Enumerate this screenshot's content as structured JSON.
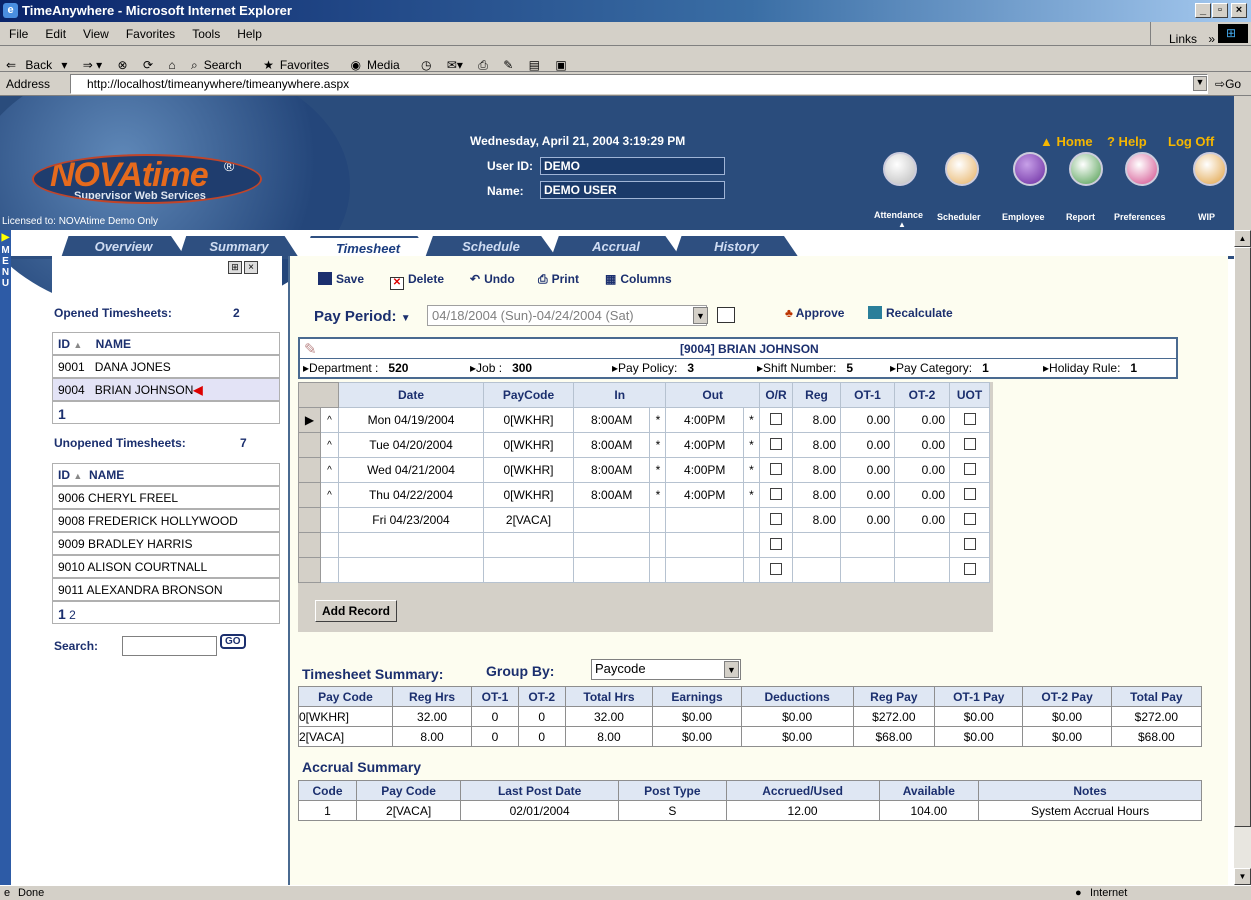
{
  "window": {
    "title": "TimeAnywhere - Microsoft Internet Explorer"
  },
  "menu": [
    "File",
    "Edit",
    "View",
    "Favorites",
    "Tools",
    "Help"
  ],
  "links_label": "Links",
  "toolbar": {
    "back": "Back",
    "search": "Search",
    "favorites": "Favorites",
    "media": "Media"
  },
  "address": {
    "label": "Address",
    "url": "http://localhost/timeanywhere/timeanywhere.aspx",
    "go": "Go"
  },
  "header": {
    "datetime": "Wednesday, April 21, 2004 3:19:29 PM",
    "userid_label": "User ID:",
    "userid": "DEMO",
    "name_label": "Name:",
    "name": "DEMO USER",
    "logo": "NOVAtime",
    "logo_reg": "®",
    "logo_sub": "Supervisor Web Services",
    "licensed": "Licensed to: NOVAtime Demo Only",
    "home": "Home",
    "help": "? Help",
    "logoff": "Log Off",
    "nav": [
      "Attendance",
      "Scheduler",
      "Employee",
      "Report",
      "Preferences",
      "WIP"
    ]
  },
  "menu_strip": "MENU",
  "tabs": [
    "Overview",
    "Summary",
    "Timesheet",
    "Schedule",
    "Accrual",
    "History"
  ],
  "left": {
    "opened_label": "Opened Timesheets:",
    "opened_count": "2",
    "id_hdr": "ID",
    "name_hdr": "NAME",
    "opened": [
      {
        "id": "9001",
        "name": "DANA JONES"
      },
      {
        "id": "9004",
        "name": "BRIAN JOHNSON"
      }
    ],
    "opened_page": "1",
    "unopened_label": "Unopened Timesheets:",
    "unopened_count": "7",
    "unopened": [
      "9006 CHERYL FREEL",
      "9008 FREDERICK HOLLYWOOD",
      "9009 BRADLEY HARRIS",
      "9010 ALISON COURTNALL",
      "9011 ALEXANDRA BRONSON"
    ],
    "pages": [
      "1",
      "2"
    ],
    "search_label": "Search:",
    "go": "GO"
  },
  "actions": {
    "save": "Save",
    "delete": "Delete",
    "undo": "Undo",
    "print": "Print",
    "columns": "Columns"
  },
  "pay_period": {
    "label": "Pay Period:",
    "value": "04/18/2004 (Sun)-04/24/2004 (Sat)",
    "approve": "Approve",
    "recalc": "Recalculate"
  },
  "employee": {
    "title": "[9004] BRIAN JOHNSON",
    "fields": [
      {
        "label": "Department :",
        "value": "520"
      },
      {
        "label": "Job :",
        "value": "300"
      },
      {
        "label": "Pay Policy:",
        "value": "3"
      },
      {
        "label": "Shift Number:",
        "value": "5"
      },
      {
        "label": "Pay Category:",
        "value": "1"
      },
      {
        "label": "Holiday Rule:",
        "value": "1"
      }
    ]
  },
  "timesheet": {
    "columns": [
      "Date",
      "PayCode",
      "In",
      "Out",
      "O/R",
      "Reg",
      "OT-1",
      "OT-2",
      "UOT"
    ],
    "rows": [
      {
        "a": "^",
        "date": "Mon 04/19/2004",
        "pay": "0[WKHR]",
        "in": "8:00AM",
        "is": "*",
        "out": "4:00PM",
        "os": "*",
        "reg": "8.00",
        "ot1": "0.00",
        "ot2": "0.00"
      },
      {
        "a": "^",
        "date": "Tue 04/20/2004",
        "pay": "0[WKHR]",
        "in": "8:00AM",
        "is": "*",
        "out": "4:00PM",
        "os": "*",
        "reg": "8.00",
        "ot1": "0.00",
        "ot2": "0.00"
      },
      {
        "a": "^",
        "date": "Wed 04/21/2004",
        "pay": "0[WKHR]",
        "in": "8:00AM",
        "is": "*",
        "out": "4:00PM",
        "os": "*",
        "reg": "8.00",
        "ot1": "0.00",
        "ot2": "0.00"
      },
      {
        "a": "^",
        "date": "Thu 04/22/2004",
        "pay": "0[WKHR]",
        "in": "8:00AM",
        "is": "*",
        "out": "4:00PM",
        "os": "*",
        "reg": "8.00",
        "ot1": "0.00",
        "ot2": "0.00"
      },
      {
        "a": "",
        "date": "Fri 04/23/2004",
        "pay": "2[VACA]",
        "in": "",
        "is": "",
        "out": "",
        "os": "",
        "reg": "8.00",
        "ot1": "0.00",
        "ot2": "0.00"
      },
      {
        "a": "",
        "date": "",
        "pay": "",
        "in": "",
        "is": "",
        "out": "",
        "os": "",
        "reg": "",
        "ot1": "",
        "ot2": ""
      },
      {
        "a": "",
        "date": "",
        "pay": "",
        "in": "",
        "is": "",
        "out": "",
        "os": "",
        "reg": "",
        "ot1": "",
        "ot2": ""
      }
    ],
    "add_record": "Add Record"
  },
  "summary": {
    "label": "Timesheet Summary:",
    "group_by_label": "Group By:",
    "group_by": "Paycode",
    "columns": [
      "Pay Code",
      "Reg Hrs",
      "OT-1",
      "OT-2",
      "Total Hrs",
      "Earnings",
      "Deductions",
      "Reg Pay",
      "OT-1 Pay",
      "OT-2 Pay",
      "Total Pay"
    ],
    "rows": [
      [
        "0[WKHR]",
        "32.00",
        "0",
        "0",
        "32.00",
        "$0.00",
        "$0.00",
        "$272.00",
        "$0.00",
        "$0.00",
        "$272.00"
      ],
      [
        "2[VACA]",
        "8.00",
        "0",
        "0",
        "8.00",
        "$0.00",
        "$0.00",
        "$68.00",
        "$0.00",
        "$0.00",
        "$68.00"
      ]
    ]
  },
  "accrual": {
    "label": "Accrual Summary",
    "columns": [
      "Code",
      "Pay Code",
      "Last Post Date",
      "Post Type",
      "Accrued/Used",
      "Available",
      "Notes"
    ],
    "rows": [
      [
        "1",
        "2[VACA]",
        "02/01/2004",
        "S",
        "12.00",
        "104.00",
        "System Accrual Hours"
      ]
    ]
  },
  "status": {
    "text": "Done",
    "zone": "Internet"
  }
}
